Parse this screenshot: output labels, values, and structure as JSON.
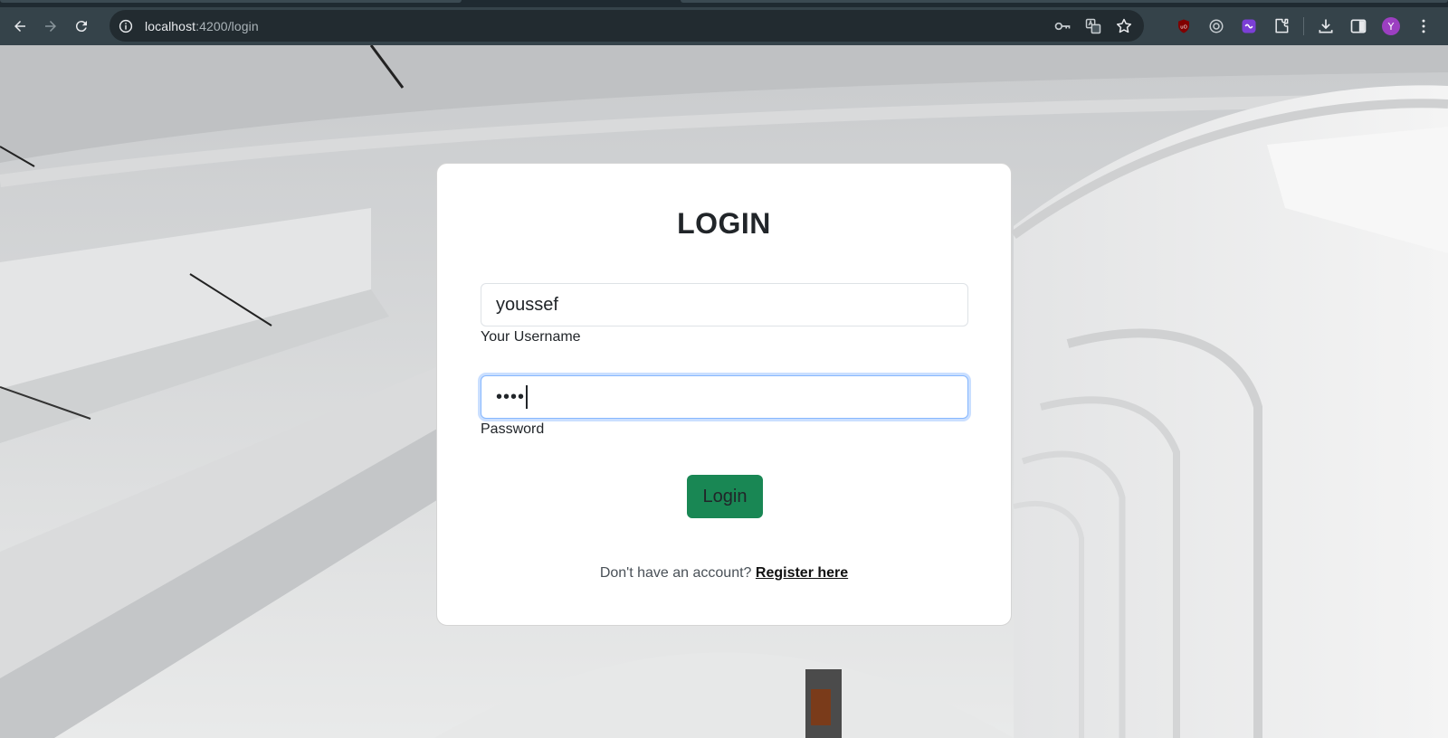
{
  "browser": {
    "url_host": "localhost",
    "url_path": ":4200/login",
    "avatar_letter": "Y",
    "toolbar_icons": [
      "back-icon",
      "forward-icon",
      "reload-icon",
      "site-info-icon",
      "password-key-icon",
      "translate-icon",
      "bookmark-star-icon",
      "ublock-icon",
      "extension-circle-icon",
      "extension-purple-icon",
      "extensions-puzzle-icon",
      "downloads-icon",
      "side-panel-icon",
      "profile-avatar",
      "menu-dots-icon"
    ]
  },
  "login": {
    "title": "LOGIN",
    "username_value": "youssef",
    "username_label": "Your Username",
    "password_value": "••••",
    "password_label": "Password",
    "button_label": "Login",
    "footer_prompt": "Don't have an account? ",
    "register_link": "Register here"
  },
  "colors": {
    "button": "#198754",
    "focus_border": "#86b7fe",
    "toolbar": "#35434a"
  }
}
